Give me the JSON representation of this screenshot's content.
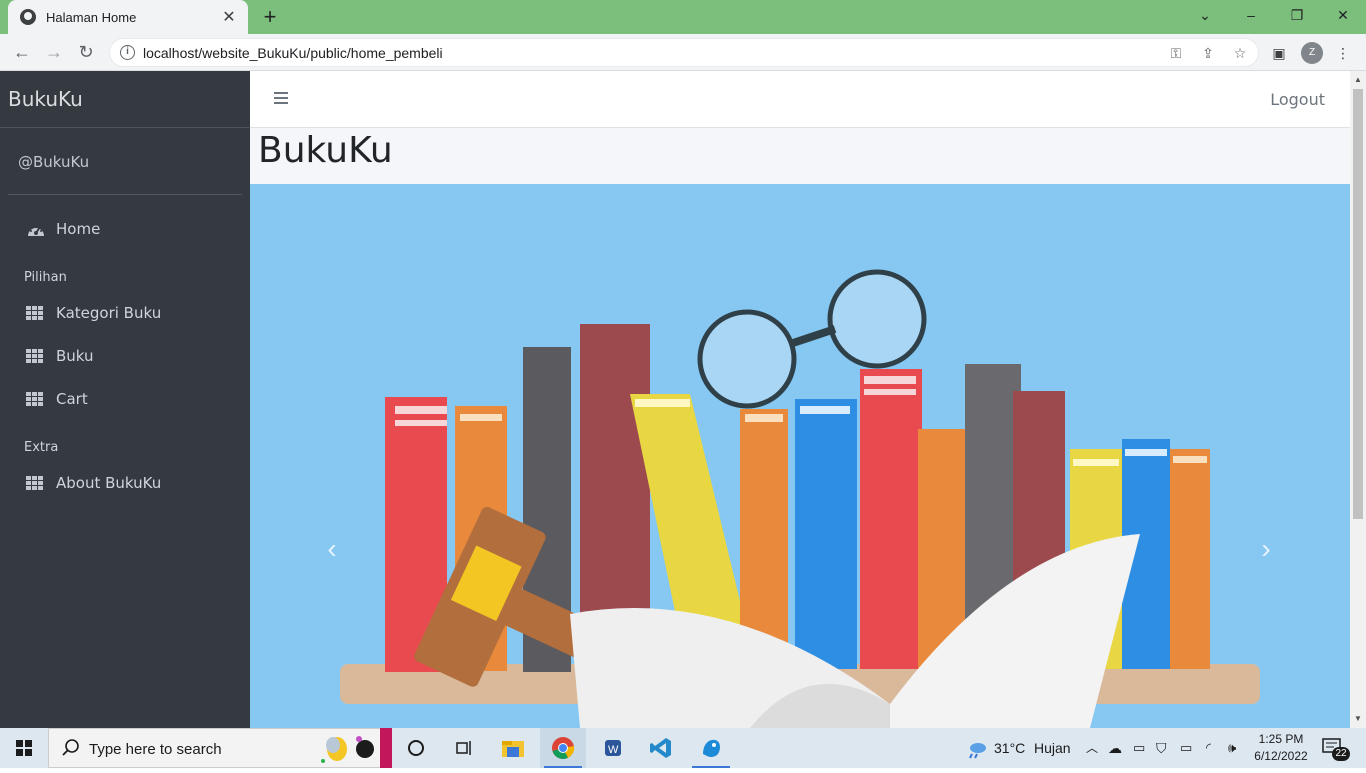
{
  "browser": {
    "tab_title": "Halaman Home",
    "url": "localhost/website_BukuKu/public/home_pembeli",
    "profile_initial": "Z"
  },
  "sidebar": {
    "brand": "BukuKu",
    "user": "@BukuKu",
    "items": [
      {
        "label": "Home",
        "icon": "dashboard-gauge-icon"
      },
      {
        "header": "Pilihan"
      },
      {
        "label": "Kategori Buku",
        "icon": "grid-icon"
      },
      {
        "label": "Buku",
        "icon": "grid-icon"
      },
      {
        "label": "Cart",
        "icon": "grid-icon"
      },
      {
        "header": "Extra"
      },
      {
        "label": "About BukuKu",
        "icon": "grid-icon"
      }
    ]
  },
  "topnav": {
    "logout_label": "Logout"
  },
  "content": {
    "title": "BukuKu",
    "carousel": {
      "background": "#86c8f2",
      "image_description_icon": "books-gavel-glasses-illustration"
    }
  },
  "taskbar": {
    "search_placeholder": "Type here to search",
    "weather_temp": "31°C",
    "weather_text": "Hujan",
    "time": "1:25 PM",
    "date": "6/12/2022",
    "notification_count": "22"
  },
  "colors": {
    "sidebar_bg": "#343a40",
    "tabstrip_bg": "#7cbf7c",
    "carousel_bg": "#86c8f2"
  }
}
